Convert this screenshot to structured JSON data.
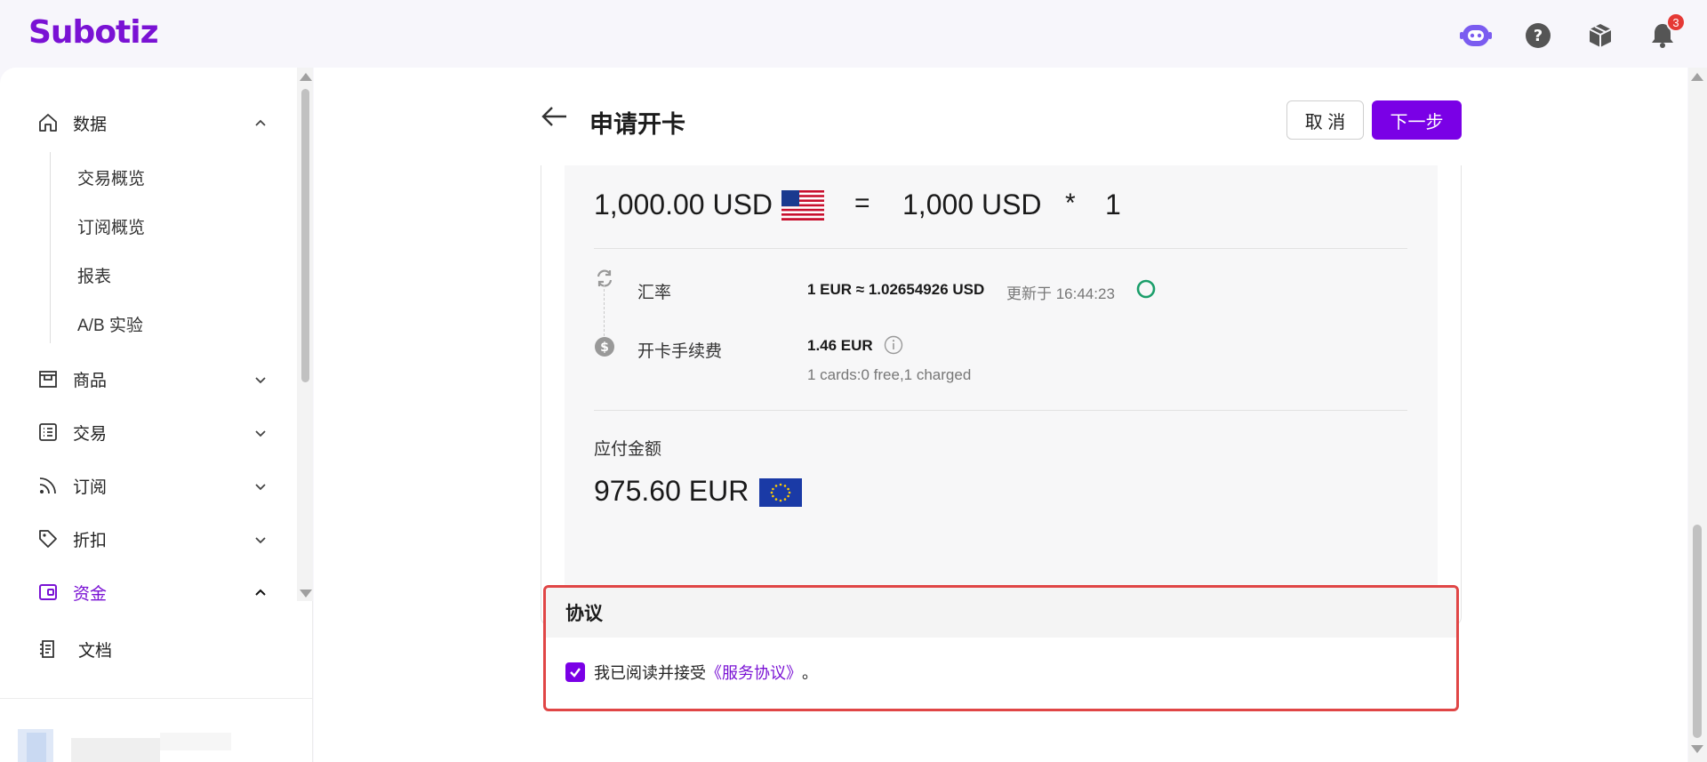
{
  "app": {
    "logo": "Subotiz",
    "brand_color": "#7a12d4",
    "notification_count": "3"
  },
  "header_icons": [
    "assistant-bot-icon",
    "help-icon",
    "package-icon",
    "bell-icon"
  ],
  "sidebar": {
    "items": [
      {
        "label": "数据",
        "icon": "home-icon",
        "expanded": true
      },
      {
        "label": "商品",
        "icon": "store-icon",
        "expanded": false
      },
      {
        "label": "交易",
        "icon": "list-icon",
        "expanded": false
      },
      {
        "label": "订阅",
        "icon": "rss-icon",
        "expanded": false
      },
      {
        "label": "折扣",
        "icon": "tag-icon",
        "expanded": false
      },
      {
        "label": "资金",
        "icon": "wallet-icon",
        "expanded": true,
        "active": true
      },
      {
        "label": "文档",
        "icon": "document-icon"
      }
    ],
    "sub_items": [
      "交易概览",
      "订阅概览",
      "报表",
      "A/B 实验"
    ]
  },
  "page": {
    "title": "申请开卡",
    "cancel_label": "取 消",
    "next_label": "下一步"
  },
  "summary": {
    "total_amount": "1,000.00 USD",
    "equals": "=",
    "per_card_amount": "1,000 USD",
    "times": "*",
    "card_count": "1",
    "rate_label": "汇率",
    "rate_value": "1 EUR ≈ 1.02654926 USD",
    "rate_updated": "更新于 16:44:23",
    "fee_label": "开卡手续费",
    "fee_value": "1.46 EUR",
    "fee_detail": "1 cards:0 free,1 charged",
    "payable_label": "应付金额",
    "payable_value": "975.60 EUR"
  },
  "agreement": {
    "title": "协议",
    "text": "我已阅读并接受",
    "link": "《服务协议》",
    "suffix": "。",
    "checked": true
  }
}
